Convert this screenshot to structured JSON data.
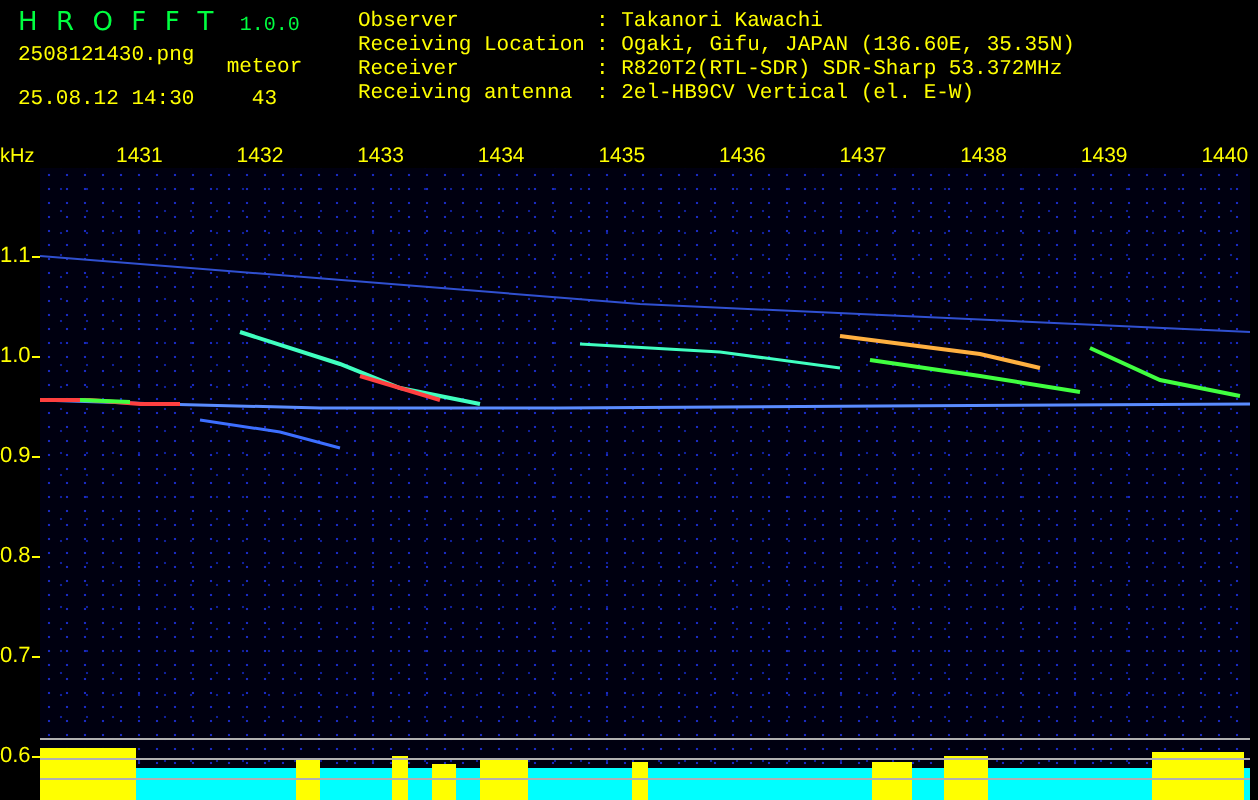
{
  "app": {
    "name": "HROFFT",
    "version": "1.0.0"
  },
  "file": {
    "filename": "2508121430.png",
    "datetime": "25.08.12 14:30"
  },
  "meteor": {
    "label": "meteor",
    "count": "43"
  },
  "info": [
    {
      "label": "Observer",
      "value": ": Takanori Kawachi"
    },
    {
      "label": "Receiving Location",
      "value": ": Ogaki, Gifu, JAPAN (136.60E, 35.35N)"
    },
    {
      "label": "Receiver",
      "value": ": R820T2(RTL-SDR) SDR-Sharp 53.372MHz"
    },
    {
      "label": "Receiving antenna",
      "value": ": 2el-HB9CV Vertical (el. E-W)"
    }
  ],
  "spectrogram": {
    "y_unit": "kHz",
    "x_ticks": [
      "1431",
      "1432",
      "1433",
      "1434",
      "1435",
      "1436",
      "1437",
      "1438",
      "1439",
      "1440"
    ],
    "y_ticks": [
      "1.1",
      "1.0",
      "0.9",
      "0.8",
      "0.7",
      "0.6"
    ]
  }
}
